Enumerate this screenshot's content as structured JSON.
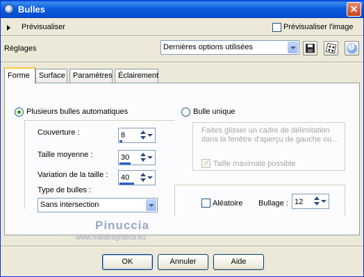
{
  "window": {
    "title": "Bulles",
    "close_label": "✕"
  },
  "preview": {
    "label": "Prévisualiser",
    "preview_image_label": "Prévisualiser l'image",
    "preview_image_checked": false
  },
  "settings": {
    "label": "Réglages",
    "preset_value": "Dernières options utilisées"
  },
  "tabs": [
    {
      "label": "Forme",
      "active": true
    },
    {
      "label": "Surface",
      "active": false
    },
    {
      "label": "Paramètres",
      "active": false
    },
    {
      "label": "Éclairement",
      "active": false
    }
  ],
  "forme": {
    "auto_bubbles_label": "Plusieurs bulles automatiques",
    "auto_bubbles_selected": true,
    "coverage_label": "Couverture :",
    "coverage_value": "8",
    "coverage_fill": 0.08,
    "avg_size_label": "Taille moyenne :",
    "avg_size_value": "30",
    "avg_size_fill": 0.3,
    "size_variation_label": "Variation de la taille :",
    "size_variation_value": "40",
    "size_variation_fill": 0.4,
    "bubble_type_label": "Type de bulles :",
    "bubble_type_value": "Sans intersection",
    "single_bubble_label": "Bulle unique",
    "single_bubble_selected": false,
    "single_bubble_hint": "Faites glisser un cadre de délimitation dans la fenêtre d'aperçu de gauche ou...",
    "max_size_label": "Taille maximale possible",
    "max_size_checked": true,
    "random_label": "Aléatoire",
    "random_checked": false,
    "seed_label": "Bullage :",
    "seed_value": "12"
  },
  "watermark": {
    "name": "Pinuccia",
    "url": "www.maidiregrafica.eu"
  },
  "buttons": {
    "ok": "OK",
    "cancel": "Annuler",
    "help": "Aide"
  },
  "colors": {
    "title_bar": "#0b5ddc",
    "dialog_bg": "#ece9d8",
    "active_tab_accent": "#ffc83c",
    "radio_dot": "#21a121"
  }
}
